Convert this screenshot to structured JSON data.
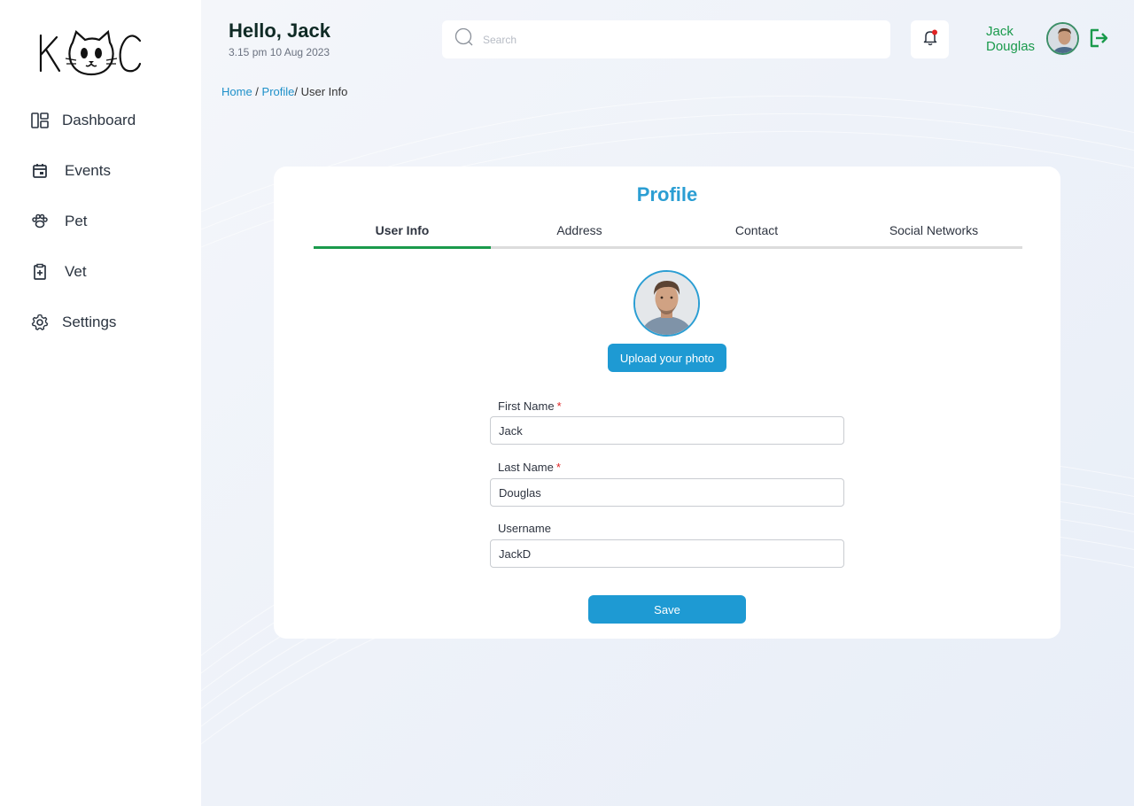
{
  "app": {
    "logo_text": "KAC"
  },
  "sidebar": {
    "items": [
      {
        "label": "Dashboard",
        "icon": "layout-icon"
      },
      {
        "label": "Events",
        "icon": "calendar-icon"
      },
      {
        "label": "Pet",
        "icon": "paw-icon"
      },
      {
        "label": "Vet",
        "icon": "clipboard-plus-icon"
      },
      {
        "label": "Settings",
        "icon": "gear-icon"
      }
    ]
  },
  "header": {
    "greeting": "Hello, Jack",
    "datetime": "3.15 pm 10 Aug 2023",
    "search_placeholder": "Search",
    "user_first": "Jack",
    "user_last": "Douglas"
  },
  "breadcrumb": {
    "home": "Home",
    "sep1": " / ",
    "profile": "Profile",
    "sep2": "/ ",
    "current": "User Info"
  },
  "profile": {
    "title": "Profile",
    "tabs": [
      "User Info",
      "Address",
      "Contact",
      "Social Networks"
    ],
    "upload_label": "Upload your photo",
    "fields": {
      "first_name": {
        "label": "First Name",
        "required_mark": "*",
        "value": "Jack"
      },
      "last_name": {
        "label": "Last Name",
        "required_mark": "*",
        "value": "Douglas"
      },
      "username": {
        "label": "Username",
        "value": "JackD"
      }
    },
    "save_label": "Save"
  },
  "colors": {
    "accent_blue": "#1e9ad3",
    "accent_green": "#1a9a4c",
    "notification_dot": "#e02424"
  }
}
